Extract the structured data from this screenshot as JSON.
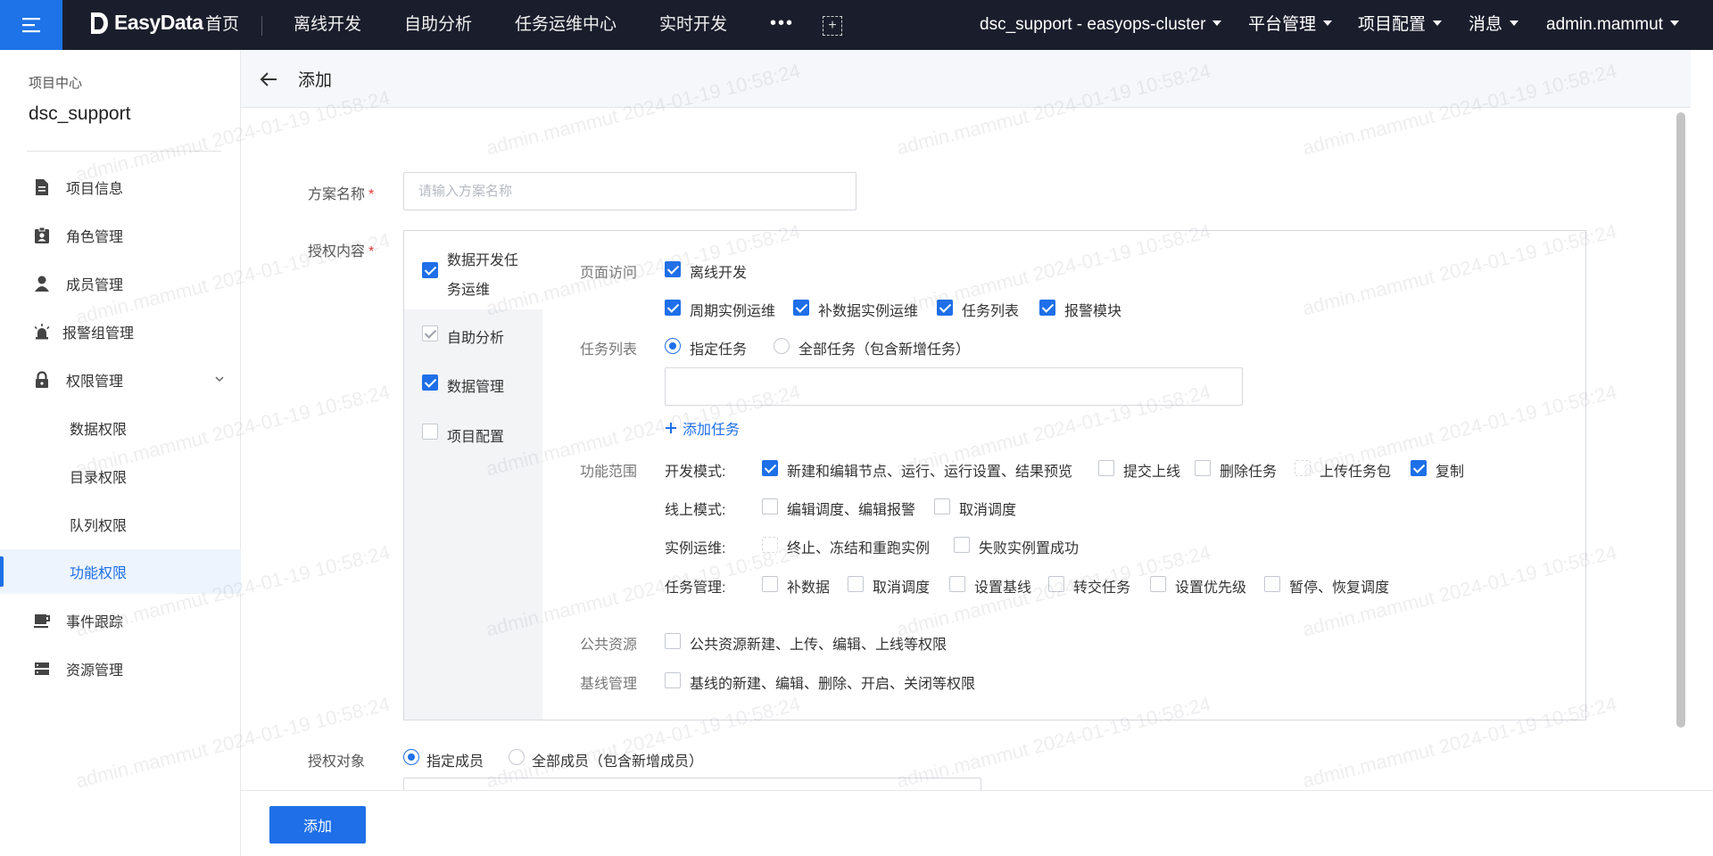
{
  "topbar": {
    "logo": "EasyData",
    "nav": [
      "首页",
      "离线开发",
      "自助分析",
      "任务运维中心",
      "实时开发"
    ],
    "more": "•••",
    "cluster": "dsc_support - easyops-cluster",
    "platform": "平台管理",
    "project_config": "项目配置",
    "messages": "消息",
    "user": "admin.mammut"
  },
  "sidebar": {
    "subtitle": "项目中心",
    "title": "dsc_support",
    "items": [
      {
        "label": "项目信息",
        "icon": "document-icon"
      },
      {
        "label": "角色管理",
        "icon": "id-badge-icon"
      },
      {
        "label": "成员管理",
        "icon": "user-icon"
      },
      {
        "label": "报警组管理",
        "icon": "alarm-icon"
      },
      {
        "label": "权限管理",
        "icon": "lock-icon"
      },
      {
        "label": "事件跟踪",
        "icon": "coffee-icon"
      },
      {
        "label": "资源管理",
        "icon": "server-icon"
      }
    ],
    "sub_items": [
      "数据权限",
      "目录权限",
      "队列权限",
      "功能权限"
    ]
  },
  "page": {
    "title": "添加",
    "scheme_label": "方案名称",
    "scheme_placeholder": "请输入方案名称",
    "scheme_value": "",
    "auth_label": "授权内容",
    "target_label": "授权对象",
    "required_mark": "*"
  },
  "auth_modules": [
    {
      "label_line1": "数据开发任",
      "label_line2": "务运维",
      "checked": true
    },
    {
      "label": "自助分析",
      "checked": "disabled"
    },
    {
      "label": "数据管理",
      "checked": true
    },
    {
      "label": "项目配置",
      "checked": false
    }
  ],
  "detail": {
    "page_access_label": "页面访问",
    "offline_dev": "离线开发",
    "page_access_items": [
      "周期实例运维",
      "补数据实例运维",
      "任务列表",
      "报警模块"
    ],
    "task_list_label": "任务列表",
    "task_radio": [
      "指定任务",
      "全部任务（包含新增任务）"
    ],
    "add_task": "添加任务",
    "scope_label": "功能范围",
    "dev_mode_label": "开发模式:",
    "dev_mode_items": [
      "新建和编辑节点、运行、运行设置、结果预览",
      "提交上线",
      "删除任务",
      "上传任务包",
      "复制"
    ],
    "online_mode_label": "线上模式:",
    "online_mode_items": [
      "编辑调度、编辑报警",
      "取消调度"
    ],
    "instance_label": "实例运维:",
    "instance_items": [
      "终止、冻结和重跑实例",
      "失败实例置成功"
    ],
    "task_mgmt_label": "任务管理:",
    "task_mgmt_items": [
      "补数据",
      "取消调度",
      "设置基线",
      "转交任务",
      "设置优先级",
      "暂停、恢复调度"
    ],
    "public_label": "公共资源",
    "public_item": "公共资源新建、上传、编辑、上线等权限",
    "baseline_label": "基线管理",
    "baseline_item": "基线的新建、编辑、删除、开启、关闭等权限"
  },
  "target": {
    "radio": [
      "指定成员",
      "全部成员（包含新增成员）"
    ]
  },
  "footer": {
    "submit": "添加"
  },
  "watermark": "admin.mammut 2024-01-19 10:58:24",
  "colors": {
    "accent": "#1e6fe8",
    "topbar": "#1a1e2c",
    "menu_btn": "#1e73e8"
  }
}
